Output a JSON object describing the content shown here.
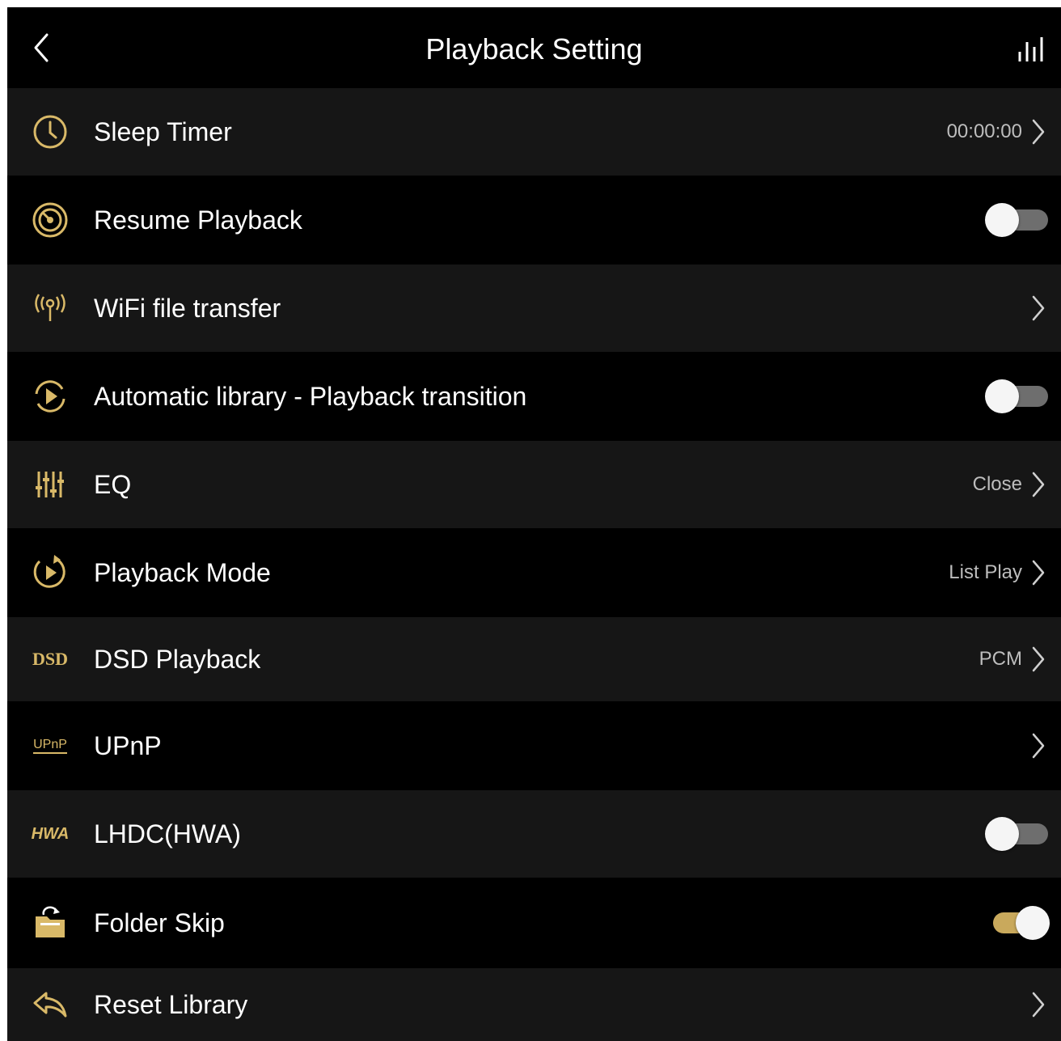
{
  "header": {
    "title": "Playback Setting",
    "back_icon": "chevron-left-icon",
    "eq_icon": "equalizer-bars-icon"
  },
  "colors": {
    "accent_gold": "#d9b968",
    "row_dark": "#161616",
    "row_black": "#000000",
    "toggle_on_track": "#c9a95c",
    "toggle_off_track": "#6e6e6e"
  },
  "rows": [
    {
      "label": "Sleep Timer",
      "value": "00:00:00",
      "icon": "clock-icon"
    },
    {
      "label": "Resume Playback",
      "icon": "resume-disc-icon",
      "toggle": "off"
    },
    {
      "label": "WiFi file transfer",
      "icon": "wifi-antenna-icon"
    },
    {
      "label": "Automatic library - Playback transition",
      "icon": "play-transition-icon",
      "toggle": "off"
    },
    {
      "label": "EQ",
      "value": "Close",
      "icon": "eq-sliders-icon"
    },
    {
      "label": "Playback Mode",
      "value": "List Play",
      "icon": "playback-mode-icon"
    },
    {
      "label": "DSD Playback",
      "value": "PCM",
      "icon": "dsd-icon",
      "icon_text": "DSD"
    },
    {
      "label": "UPnP",
      "icon": "upnp-icon",
      "icon_text": "UPnP"
    },
    {
      "label": "LHDC(HWA)",
      "icon": "hwa-icon",
      "icon_text": "HWA",
      "toggle": "off"
    },
    {
      "label": "Folder Skip",
      "icon": "folder-skip-icon",
      "toggle": "on"
    },
    {
      "label": "Reset Library",
      "icon": "reset-arrow-icon"
    }
  ]
}
